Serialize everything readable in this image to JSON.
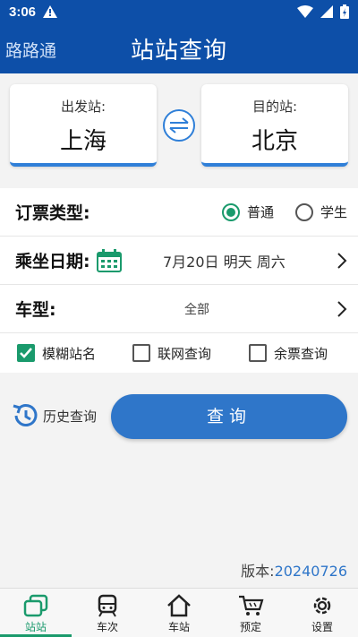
{
  "status_bar": {
    "time": "3:06"
  },
  "app_bar": {
    "app_name": "路路通",
    "title": "站站查询"
  },
  "stations": {
    "from_label": "出发站:",
    "from_name": "上海",
    "to_label": "目的站:",
    "to_name": "北京"
  },
  "ticket_type": {
    "label": "订票类型:",
    "options": [
      "普通",
      "学生"
    ],
    "selected": "普通"
  },
  "date": {
    "label": "乘坐日期:",
    "value": "7月20日 明天 周六"
  },
  "train_type": {
    "label": "车型:",
    "value": "全部"
  },
  "checkboxes": [
    {
      "label": "模糊站名",
      "checked": true
    },
    {
      "label": "联网查询",
      "checked": false
    },
    {
      "label": "余票查询",
      "checked": false
    }
  ],
  "history": {
    "label": "历史查询"
  },
  "query_button": {
    "label": "查询"
  },
  "version": {
    "prefix": "版本:",
    "number": "20240726"
  },
  "bottom_nav": [
    {
      "label": "站站",
      "icon": "station-to-station-icon",
      "active": true
    },
    {
      "label": "车次",
      "icon": "train-icon",
      "active": false
    },
    {
      "label": "车站",
      "icon": "house-icon",
      "active": false
    },
    {
      "label": "预定",
      "icon": "cart-icon",
      "active": false
    },
    {
      "label": "设置",
      "icon": "gear-icon",
      "active": false
    }
  ],
  "colors": {
    "primary": "#0d4fa8",
    "accent": "#2f76c9",
    "green": "#1a9a6c"
  }
}
